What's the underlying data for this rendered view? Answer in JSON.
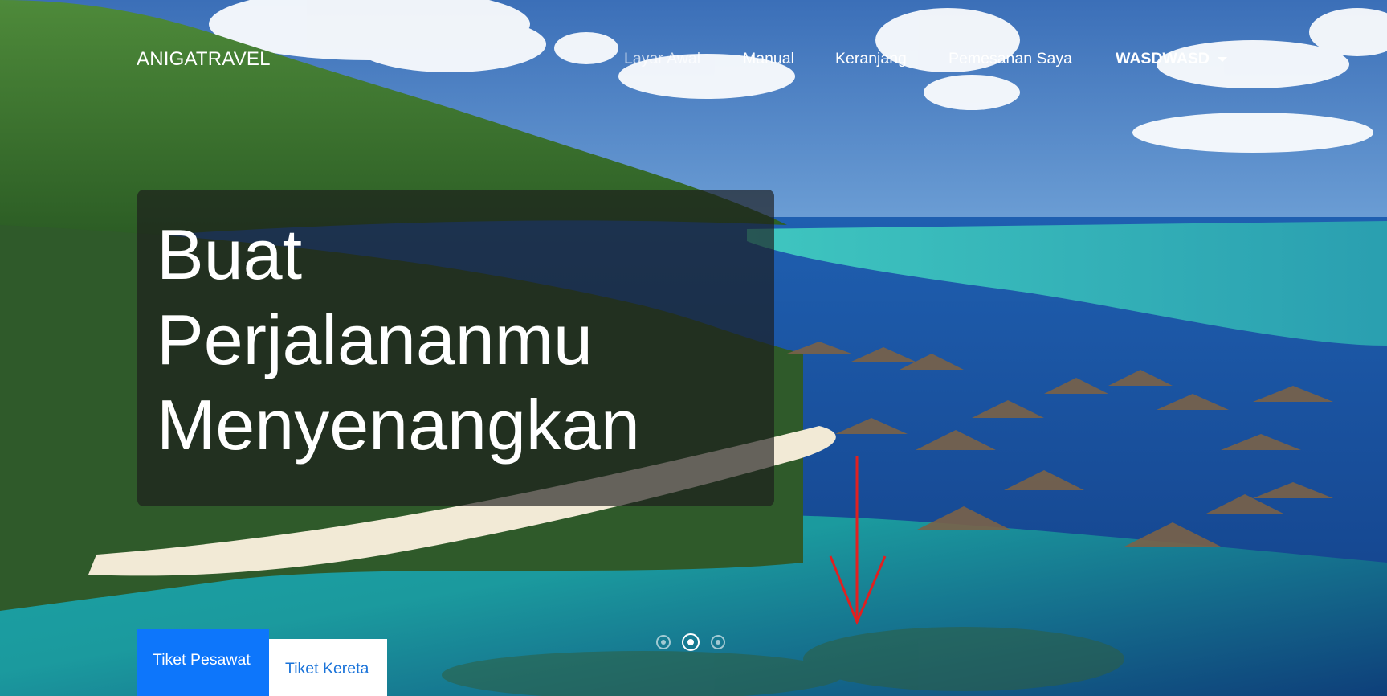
{
  "navbar": {
    "brand": "ANIGATRAVEL",
    "items": [
      {
        "label": "Layar Awal",
        "muted": true
      },
      {
        "label": "Manual"
      },
      {
        "label": "Keranjang"
      },
      {
        "label": "Pemesanan Saya"
      }
    ],
    "user_dropdown": "WASDWASD"
  },
  "hero": {
    "headline_lines": [
      "Buat",
      "Perjalananmu",
      "Menyenangkan"
    ]
  },
  "carousel": {
    "slide_count": 3,
    "active_index": 1
  },
  "tabs": {
    "flight_label": "Tiket Pesawat",
    "train_label": "Tiket Kereta"
  },
  "colors": {
    "primary": "#0d76fb",
    "annotation_arrow": "#e02020"
  },
  "icons": {
    "dropdown": "caret-down-icon",
    "annotation": "arrow-down-icon"
  }
}
